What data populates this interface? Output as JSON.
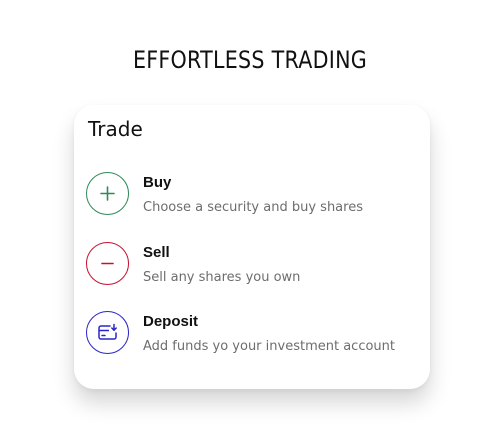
{
  "headline": "EFFORTLESS TRADING",
  "card": {
    "title": "Trade",
    "items": [
      {
        "label": "Buy",
        "description": "Choose a security and buy shares",
        "icon": "plus-icon",
        "color": "#2e8b57"
      },
      {
        "label": "Sell",
        "description": "Sell any shares you own",
        "icon": "minus-icon",
        "color": "#c8102e"
      },
      {
        "label": "Deposit",
        "description": "Add funds yo your investment account",
        "icon": "deposit-icon",
        "color": "#2b25c9"
      }
    ]
  }
}
